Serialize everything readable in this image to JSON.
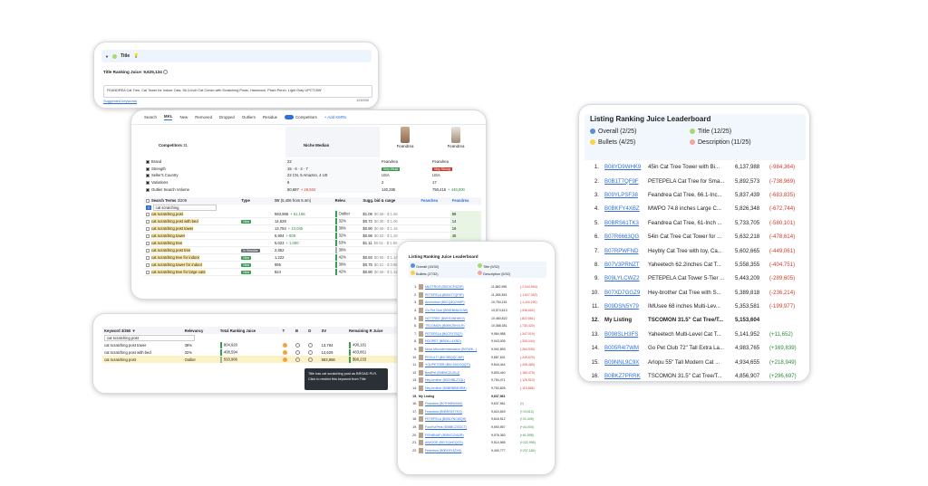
{
  "panel_title": {
    "label": "Title",
    "ranking_label": "Title Ranking Juice",
    "ranking_value": "9,625,134",
    "text": "FEANDREA Cat Tree, Cat Tower for Indoor Cats, 56.3-Inch Cat Condo with Scratching Posts, Hammock, Plush Perch, Light Gray UPCT15W",
    "count": "129/200",
    "suggest": "Suggested keywords"
  },
  "competitors": {
    "tabs": [
      "Search",
      "MKL",
      "New",
      "Removed",
      "Dropped",
      "Outliers",
      "Residue",
      "Competitors",
      "+ Add KMRs"
    ],
    "competitors_label": "Competitors",
    "competitors_count": "31",
    "niche_label": "Niche Median",
    "brand1": "Feandrea",
    "brand2": "Feandrea",
    "rows": [
      {
        "label": "Brand",
        "niche": "22",
        "c1": "Feandrea",
        "c2": "Feandrea"
      },
      {
        "label": "Strength",
        "niche": "15 · 6 · 4 · 7",
        "c1": "Very Weak",
        "c2": "Very Strong"
      },
      {
        "label": "Seller's Country",
        "niche": "22 CN, 5 Amazon, 4 US",
        "c1": "USA",
        "c2": "USA"
      },
      {
        "label": "Variations",
        "niche": "6",
        "c1": "2",
        "c2": "17"
      },
      {
        "label": "Outlier Search Volume",
        "niche": "50,697",
        "niche_delta": "+ 26,504",
        "c1": "140,285",
        "c2": "750,415",
        "c2_delta": "+ 449,000"
      }
    ],
    "headers": [
      "Search Terms",
      "Type",
      "SV",
      "Relev.",
      "Sugg. bid & range",
      "Feandrea",
      "Feandrea"
    ],
    "sv_sub": "(5,406 from 5.4m)",
    "search_count": "3/209",
    "filter_text": "cat scratching",
    "keywords": [
      {
        "kw": "cat scratching post",
        "type": "",
        "sv": "593,966",
        "d": "+ 61,198",
        "rel": "Outlier",
        "bid": "$1.08",
        "rng": "$0.59 - $ 1.56",
        "r1": "",
        "r2": "89",
        "c": "#3a9e52"
      },
      {
        "kw": "cat scratching post with bed",
        "type": "New",
        "sv": "14,628",
        "d": "",
        "rel": "32%",
        "bid": "$0.72",
        "rng": "$0.38 - $ 1.06",
        "r1": "",
        "r2": "14",
        "c": "#3a9e52"
      },
      {
        "kw": "cat scratching post tower",
        "type": "",
        "sv": "13,784",
        "d": "+ 13,045",
        "rel": "39%",
        "bid": "$0.90",
        "rng": "$0.59 - $ 1.16",
        "r1": "",
        "r2": "19",
        "c": "#3a9e52"
      },
      {
        "kw": "cat scratching tower",
        "type": "",
        "sv": "6,904",
        "d": "+ 808",
        "rel": "32%",
        "bid": "$0.98",
        "rng": "$0.53 - $ 1.26",
        "r1": "",
        "r2": "45",
        "c": "#3a9e52"
      },
      {
        "kw": "cat scratching tree",
        "type": "",
        "sv": "5,023",
        "d": "+ 1,080",
        "rel": "53%",
        "bid": "$1.11",
        "rng": "$0.61 - $ 1.60",
        "r1": "",
        "r2": "39",
        "c": "#3a9e52"
      },
      {
        "kw": "cat scratching post tree",
        "type": "In Residue",
        "sv": "2,852",
        "d": "",
        "rel": "39%",
        "bid": "",
        "rng": "",
        "r1": "",
        "r2": "",
        "c": "#aaa"
      },
      {
        "kw": "cat scratching tree for indoor",
        "type": "New",
        "sv": "1,222",
        "d": "",
        "rel": "42%",
        "bid": "$0.93",
        "rng": "$0.55 - $ 1.14",
        "r1": "",
        "r2": "",
        "c": "#3a9e52"
      },
      {
        "kw": "cat scratching tower for indoor",
        "type": "New",
        "sv": "995",
        "d": "",
        "rel": "39%",
        "bid": "$0.75",
        "rng": "$0.51 - $ 0.98",
        "r1": "",
        "r2": "",
        "c": "#3a9e52"
      },
      {
        "kw": "cat scratching tree for large cats",
        "type": "New",
        "sv": "824",
        "d": "",
        "rel": "42%",
        "bid": "$0.90",
        "rng": "$0.59 - $ 1.11",
        "r1": "",
        "r2": "",
        "c": "#3a9e52"
      }
    ]
  },
  "keyword_panel": {
    "headers": [
      "Keyword",
      "Relevancy",
      "Total Ranking Juice",
      "T",
      "B",
      "D",
      "SV",
      "Remaining R Juice"
    ],
    "count": "3/260",
    "filter": "cat scratching post",
    "rows": [
      {
        "kw": "cat scratching post tower",
        "rel": "39%",
        "total": "804,920",
        "sv": "13,784",
        "rem": "490,181"
      },
      {
        "kw": "cat scratching post with bed",
        "rel": "32%",
        "total": "408,594",
        "sv": "14,629",
        "rem": "483,861"
      },
      {
        "kw": "cat scratching post",
        "rel": "Outlier",
        "total": "593,966",
        "sv": "593,966",
        "rem": "$90,233"
      }
    ],
    "tooltip": "Title has cat scratching post as BROAD PLR. Click to restrict this keyword from Title"
  },
  "small_board": {
    "title": "Listing Ranking Juice Leaderboard",
    "legend": [
      "Overall (15/32)",
      "Title (9/32)",
      "Bullets (27/32)",
      "Description (5/32)"
    ],
    "rows": [
      {
        "n": "1.",
        "a": "MUTTROS (B0C3CP4Z2P)",
        "v": "11,682,955",
        "d": "(-2,044,994)",
        "c": "red"
      },
      {
        "n": "2.",
        "a": "PETEPELA (B0B1T7QF9F)",
        "v": "11,265,353",
        "d": "(-1,627,392)",
        "c": "red"
      },
      {
        "n": "3.",
        "a": "Anchortow (B0CQ4Q2VMP)",
        "v": "10,754,151",
        "d": "(-1,116,190)",
        "c": "red"
      },
      {
        "n": "4.",
        "a": "Go Pet Club (B00EBMAGUW)",
        "v": "10,574,613",
        "d": "(-936,652)",
        "c": "red"
      },
      {
        "n": "5.",
        "a": "HOTTREE (B09YDWHHK9)",
        "v": "10,460,822",
        "d": "(-822,861)",
        "c": "red"
      },
      {
        "n": "6.",
        "a": "TSCOMON (B0BKZ5HVLR)",
        "v": "10,368,381",
        "d": "(-730,420)",
        "c": "red"
      },
      {
        "n": "7.",
        "a": "PETEPELA (B0CFX7SQ7)",
        "v": "9,984,988",
        "d": "(-347,019)",
        "c": "red"
      },
      {
        "n": "8.",
        "a": "HOOPET (B09XLL4XRD)",
        "v": "9,943,005",
        "d": "(-305,044)",
        "c": "red"
      },
      {
        "n": "9.",
        "a": "Nova Microdermabrasion (B07WK...)",
        "v": "9,902,893",
        "d": "(-264,933)",
        "c": "red"
      },
      {
        "n": "10.",
        "a": "PEOULTI (B0C5BQQCJ6F)",
        "v": "9,887,631",
        "d": "(-249,670)",
        "c": "red"
      },
      {
        "n": "11.",
        "a": "YOUPETSER (B0C1BCGQQTI)",
        "v": "9,844,444",
        "d": "(-206,483)",
        "c": "red"
      },
      {
        "n": "12.",
        "a": "BestPet (B0BNCZUGLJ)",
        "v": "9,803,440",
        "d": "(-165,479)",
        "c": "red"
      },
      {
        "n": "13.",
        "a": "Hey-brother (B0CHBLZ7QL)",
        "v": "9,764,471",
        "d": "(-126,510)",
        "c": "red"
      },
      {
        "n": "14.",
        "a": "Hey-brother (B0BRBB4DRM)",
        "v": "9,753,826",
        "d": "(-115,865)",
        "c": "red"
      },
      {
        "n": "15.",
        "a": "My Listing",
        "v": "9,637,961",
        "d": "",
        "c": "",
        "me": true
      },
      {
        "n": "16.",
        "a": "Feandrea (B07HH8W4MJ)",
        "v": "9,637,961",
        "d": "(0)",
        "c": "gry"
      },
      {
        "n": "17.",
        "a": "Feandrea (B0BRS6TYKX)",
        "v": "9,624,549",
        "d": "(+13,512)",
        "c": "grn"
      },
      {
        "n": "18.",
        "a": "PETEPELA (B0BLYNCWQH)",
        "v": "9,616,512",
        "d": "(+21,449)",
        "c": "grn"
      },
      {
        "n": "19.",
        "a": "FourFurPets (B08BCZGGCT)",
        "v": "9,593,957",
        "d": "(+44,004)",
        "c": "grn"
      },
      {
        "n": "20.",
        "a": "FISHBNAP (B08VGZV8JR)",
        "v": "9,576,363",
        "d": "(+61,598)",
        "c": "grn"
      },
      {
        "n": "21.",
        "a": "AIWOOE (B07CQHCQCS)",
        "v": "9,514,965",
        "d": "(+122,996)",
        "c": "grn"
      },
      {
        "n": "22.",
        "a": "Feandrea (B0BX9Y4ZXK)",
        "v": "9,400,777",
        "d": "(+237,184)",
        "c": "grn"
      }
    ]
  },
  "board": {
    "title": "Listing Ranking Juice Leaderboard",
    "legend": [
      {
        "label": "Overall (2/25)",
        "color": "#5b8ed6"
      },
      {
        "label": "Title (12/25)",
        "color": "#a6d96a"
      },
      {
        "label": "Bullets (4/25)",
        "color": "#f5d547"
      },
      {
        "label": "Description (11/25)",
        "color": "#f2a7a0"
      }
    ],
    "rows": [
      {
        "n": "1.",
        "a": "B08YD9WHK9",
        "t": "45in Cat Tree Tower with Bi...",
        "v": "6,137,988",
        "d": "(-984,364)",
        "c": "red"
      },
      {
        "n": "2.",
        "a": "B0B1T7QF9F",
        "t": "PETEPELA Cat Tree for Sma...",
        "v": "5,892,573",
        "d": "(-738,969)",
        "c": "red"
      },
      {
        "n": "3.",
        "a": "B09YLPSF38",
        "t": "Feandrea Cat Tree, 66.1-Inc...",
        "v": "5,837,439",
        "d": "(-683,835)",
        "c": "red"
      },
      {
        "n": "4.",
        "a": "B0BKFY4XBZ",
        "t": "MWPO 74.8 inches Large C...",
        "v": "5,826,348",
        "d": "(-672,744)",
        "c": "red"
      },
      {
        "n": "5.",
        "a": "B0BRS61TK3",
        "t": "Feandrea Cat Tree, 61-Inch ...",
        "v": "5,733,705",
        "d": "(-580,101)",
        "c": "red"
      },
      {
        "n": "6.",
        "a": "B07R6663QG",
        "t": "54in Cat Tree Cat Tower for ...",
        "v": "5,632,218",
        "d": "(-478,614)",
        "c": "red"
      },
      {
        "n": "7.",
        "a": "B07RPWFND",
        "t": "Heybly Cat Tree with toy, Ca...",
        "v": "5,602,665",
        "d": "(-449,061)",
        "c": "red"
      },
      {
        "n": "8.",
        "a": "B07V3PRNZT",
        "t": "Yaheetech 62.2inches Cat T...",
        "v": "5,558,355",
        "d": "(-404,751)",
        "c": "red"
      },
      {
        "n": "9.",
        "a": "B09LYLCWZ2",
        "t": "PETEPELA Cat Tower 5-Tier ...",
        "v": "5,443,209",
        "d": "(-289,605)",
        "c": "red"
      },
      {
        "n": "10.",
        "a": "B07XD7GGZ9",
        "t": "Hey-brother Cat Tree with S...",
        "v": "5,389,818",
        "d": "(-236,214)",
        "c": "red"
      },
      {
        "n": "11.",
        "a": "B09DSN5Y79",
        "t": "IMUsee 68 inches Multi-Lev...",
        "v": "5,353,581",
        "d": "(-199,977)",
        "c": "red"
      },
      {
        "n": "12.",
        "a": "My Listing",
        "t": "TSCOMON 31.5\" Cat Tree/T...",
        "v": "5,153,604",
        "d": "",
        "c": "",
        "me": true
      },
      {
        "n": "13.",
        "a": "B098SLH3FS",
        "t": "Yaheetech Multi-Level Cat T...",
        "v": "5,141,952",
        "d": "(+11,652)",
        "c": "grn"
      },
      {
        "n": "14.",
        "a": "B005R4I7WM",
        "t": "Go Pet Club 72\" Tall Extra La...",
        "v": "4,983,765",
        "d": "(+169,839)",
        "c": "grn"
      },
      {
        "n": "15.",
        "a": "B09NNL9C9X",
        "t": "Arlopu 55\" Tall Modern Cat ...",
        "v": "4,934,655",
        "d": "(+218,949)",
        "c": "grn"
      },
      {
        "n": "16.",
        "a": "B0BKZ7PRRK",
        "t": "TSCOMON 31.5\" Cat Tree/T...",
        "v": "4,856,907",
        "d": "(+296,697)",
        "c": "grn"
      }
    ]
  }
}
